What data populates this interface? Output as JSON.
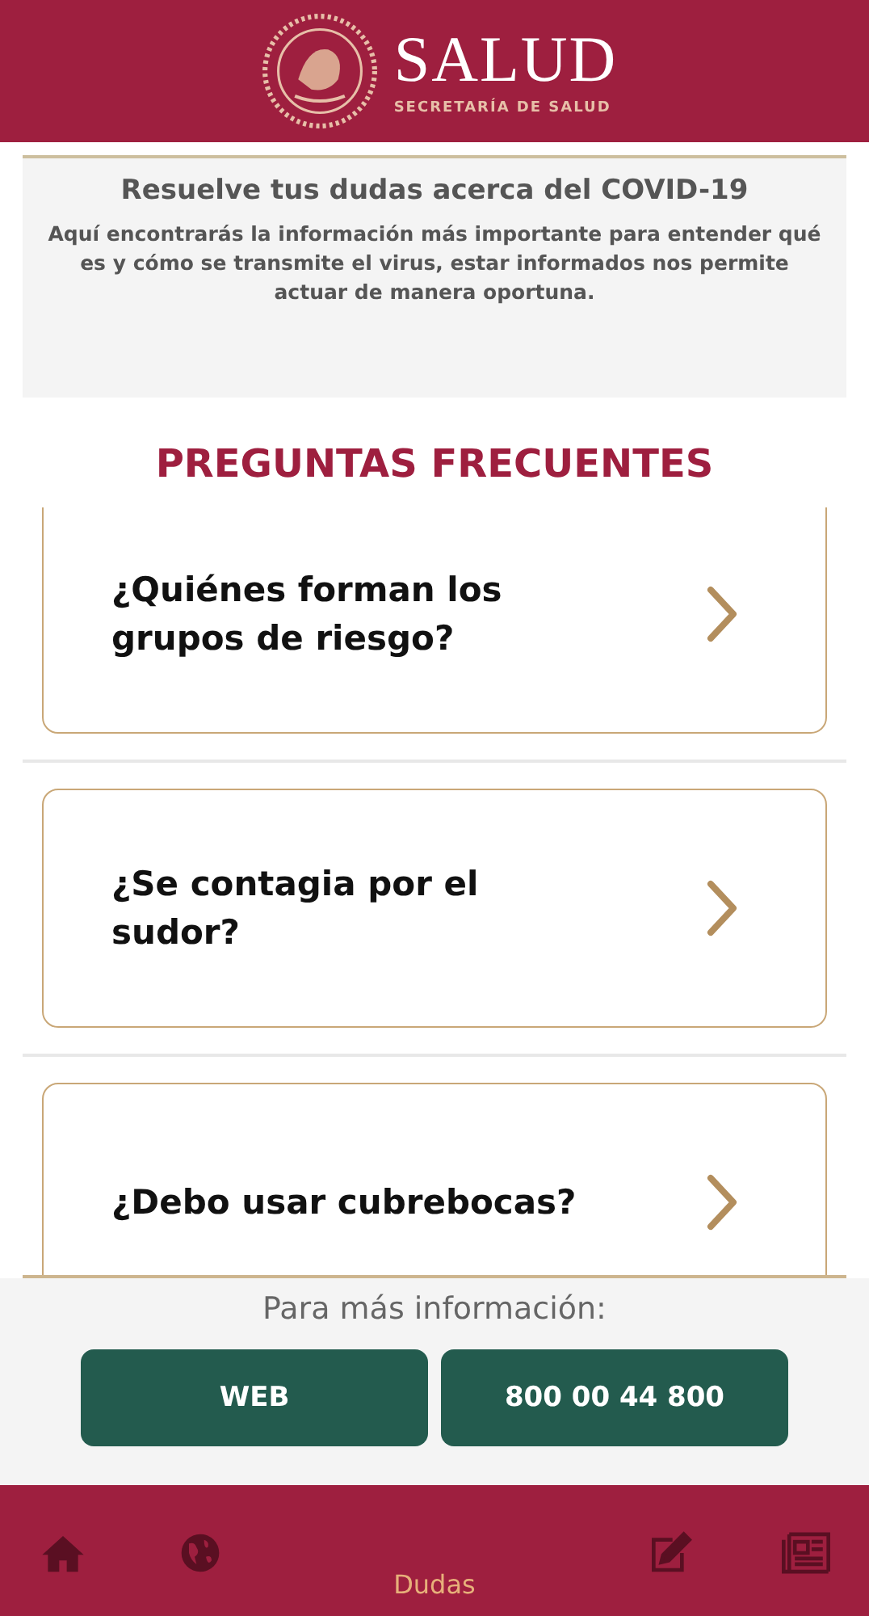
{
  "header": {
    "title": "SALUD",
    "subtitle": "SECRETARÍA DE SALUD"
  },
  "intro": {
    "title": "Resuelve tus dudas acerca del COVID-19",
    "text": "Aquí encontrarás la información más importante para entender qué es y cómo se transmite el virus, estar informados nos permite actuar de manera oportuna."
  },
  "section_title": "PREGUNTAS FRECUENTES",
  "questions": [
    {
      "text": "¿Quiénes forman los grupos de riesgo?"
    },
    {
      "text": "¿Se contagia por el sudor?"
    },
    {
      "text": "¿Debo usar cubrebocas?"
    }
  ],
  "footer": {
    "label": "Para más información:",
    "buttons": [
      "WEB",
      "800 00 44 800"
    ]
  },
  "nav": [
    {
      "kind": "home",
      "selected": false
    },
    {
      "kind": "globe",
      "selected": false
    },
    {
      "kind": "label",
      "label": "Dudas",
      "selected": true
    },
    {
      "kind": "edit",
      "selected": false
    },
    {
      "kind": "news",
      "selected": false
    }
  ]
}
